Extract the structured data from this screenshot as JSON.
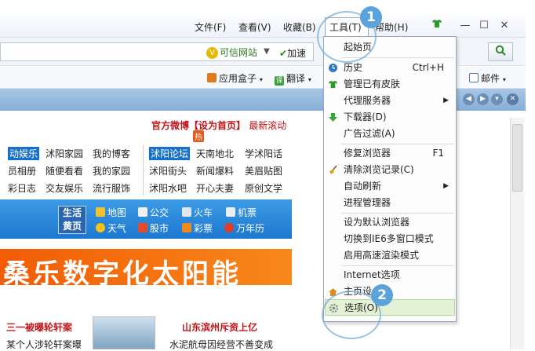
{
  "menubar": {
    "file": "文件(F)",
    "view": "查看(V)",
    "favorites": "收藏(B)",
    "tools": "工具(T)",
    "help": "帮助(H)",
    "minimize": "—",
    "restore": "☐",
    "close": "✕"
  },
  "addressbar": {
    "verified": "可信网站",
    "accelerate": "加速",
    "search_icon": "search-icon"
  },
  "toolbar": {
    "appbox": "应用盒子",
    "translate": "翻译",
    "translate_icon_char": "译",
    "mail": "邮件"
  },
  "page": {
    "weibo": "官方微博",
    "set_home": "【设为首页】",
    "news_scroll": "最新滚动",
    "hot": "热",
    "row1": [
      "动娱乐",
      "沭阳家园",
      "我的博客",
      "沭阳论坛",
      "天南地北",
      "学沭阳话"
    ],
    "row2": [
      "员相册",
      "随便看看",
      "我的家园",
      "沭阳街头",
      "新闻爆料",
      "美眉贴图"
    ],
    "row3": [
      "彩日志",
      "交友娱乐",
      "流行服饰",
      "沭阳水吧",
      "开心夫妻",
      "原创文学"
    ],
    "life_badge": [
      "生活",
      "黄页"
    ],
    "life_row1": [
      "地图",
      "公交",
      "火车",
      "机票"
    ],
    "life_row2": [
      "天气",
      "股市",
      "彩票",
      "万年历"
    ],
    "banner": "桑乐数字化太阳能",
    "news_left_title": "三一被曝轮轩案",
    "news_left_sub": "某个人涉轮轩案曝",
    "news_right_title": "山东滨州斥资上亿",
    "news_right_sub": "水泥航母因经营不善变成"
  },
  "tools_menu": {
    "items": [
      {
        "label": "起始页",
        "shortcut": ""
      },
      {
        "label": "历史",
        "shortcut": "Ctrl+H"
      },
      {
        "label": "管理已有皮肤",
        "shortcut": ""
      },
      {
        "label": "代理服务器",
        "shortcut": ""
      },
      {
        "label": "下载器(D)",
        "shortcut": ""
      },
      {
        "label": "广告过滤(A)",
        "shortcut": ""
      },
      {
        "label": "修复浏览器",
        "shortcut": "F1"
      },
      {
        "label": "清除浏览记录(C)",
        "shortcut": ""
      },
      {
        "label": "自动刷新",
        "shortcut": ""
      },
      {
        "label": "进程管理器",
        "shortcut": ""
      },
      {
        "label": "设为默认浏览器",
        "shortcut": ""
      },
      {
        "label": "切换到IE6多窗口模式",
        "shortcut": ""
      },
      {
        "label": "启用高速渲染模式",
        "shortcut": ""
      },
      {
        "label": "Internet选项",
        "shortcut": ""
      },
      {
        "label": "主页设",
        "shortcut": ""
      },
      {
        "label": "选项(O)",
        "shortcut": ""
      }
    ]
  },
  "callouts": [
    "1",
    "2"
  ],
  "colors": {
    "accent_blue": "#1770c8",
    "highlight_green": "#e3f2d4",
    "callout": "#5aa3dc"
  }
}
